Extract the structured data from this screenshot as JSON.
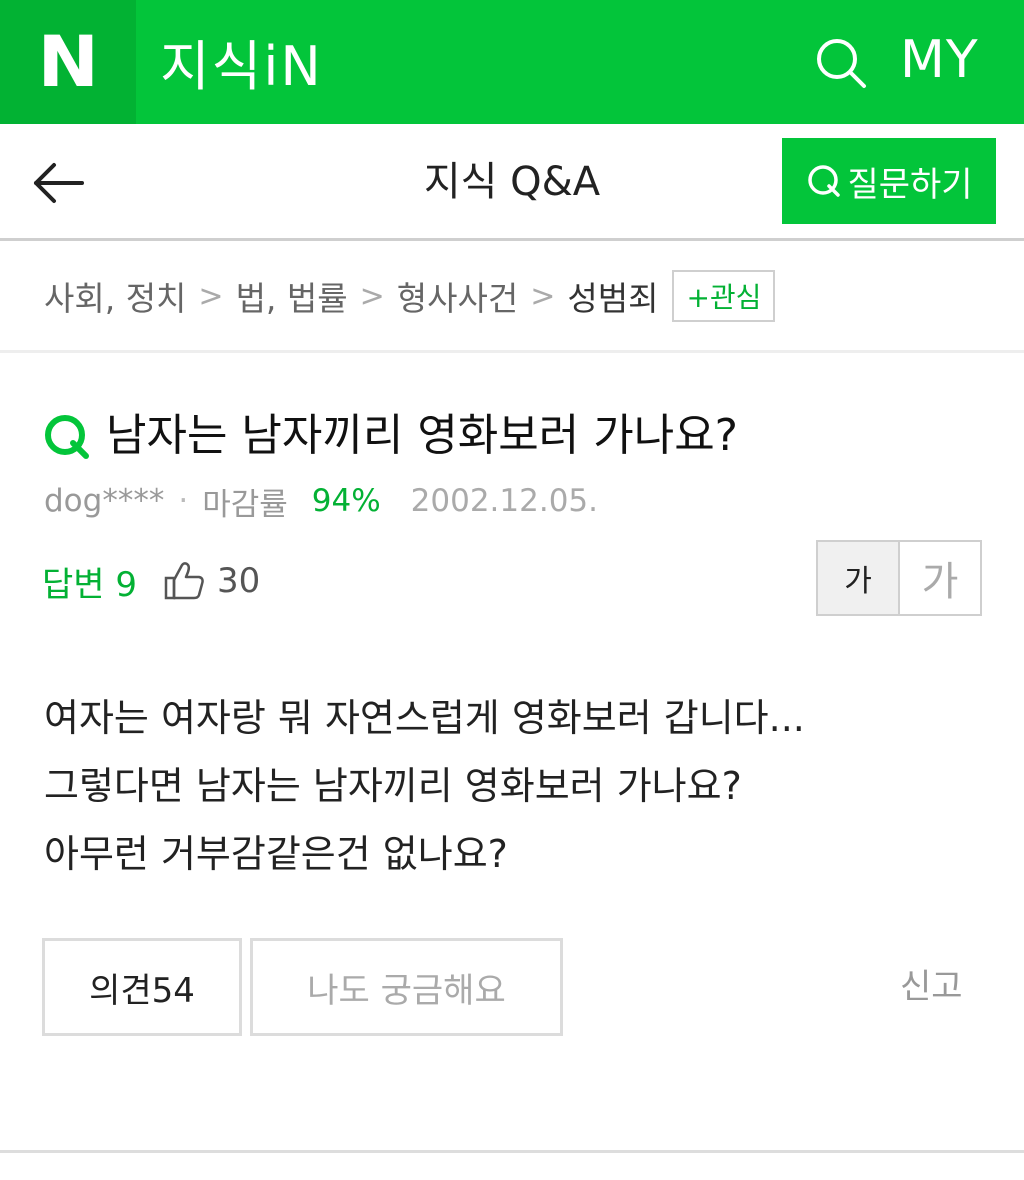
{
  "header": {
    "logo": "N",
    "brand": "지식iN",
    "search_icon": "search-icon",
    "my_label": "MY",
    "colors": {
      "brand_green": "#03c53a",
      "logo_bg": "#02b233"
    }
  },
  "subheader": {
    "back_icon": "back-arrow-icon",
    "title": "지식 Q&A",
    "ask_button": "질문하기"
  },
  "breadcrumb": {
    "items": [
      "사회, 정치",
      "법, 법률",
      "형사사건",
      "성범죄"
    ],
    "separator": ">",
    "follow_button": "+관심"
  },
  "question": {
    "title": "남자는 남자끼리 영화보러 가나요?",
    "author": "dog****",
    "rate_label": "마감률",
    "rate_value": "94%",
    "date": "2002.12.05.",
    "answers": "답변 9",
    "likes": "30",
    "font_small": "가",
    "font_large": "가",
    "body": [
      "여자는 여자랑 뭐 자연스럽게 영화보러 갑니다...",
      "그렇다면 남자는 남자끼리 영화보러 가나요?",
      "아무런 거부감같은건 없나요?"
    ]
  },
  "actions": {
    "opinion": "의견54",
    "curious": "나도 궁금해요",
    "report": "신고"
  }
}
